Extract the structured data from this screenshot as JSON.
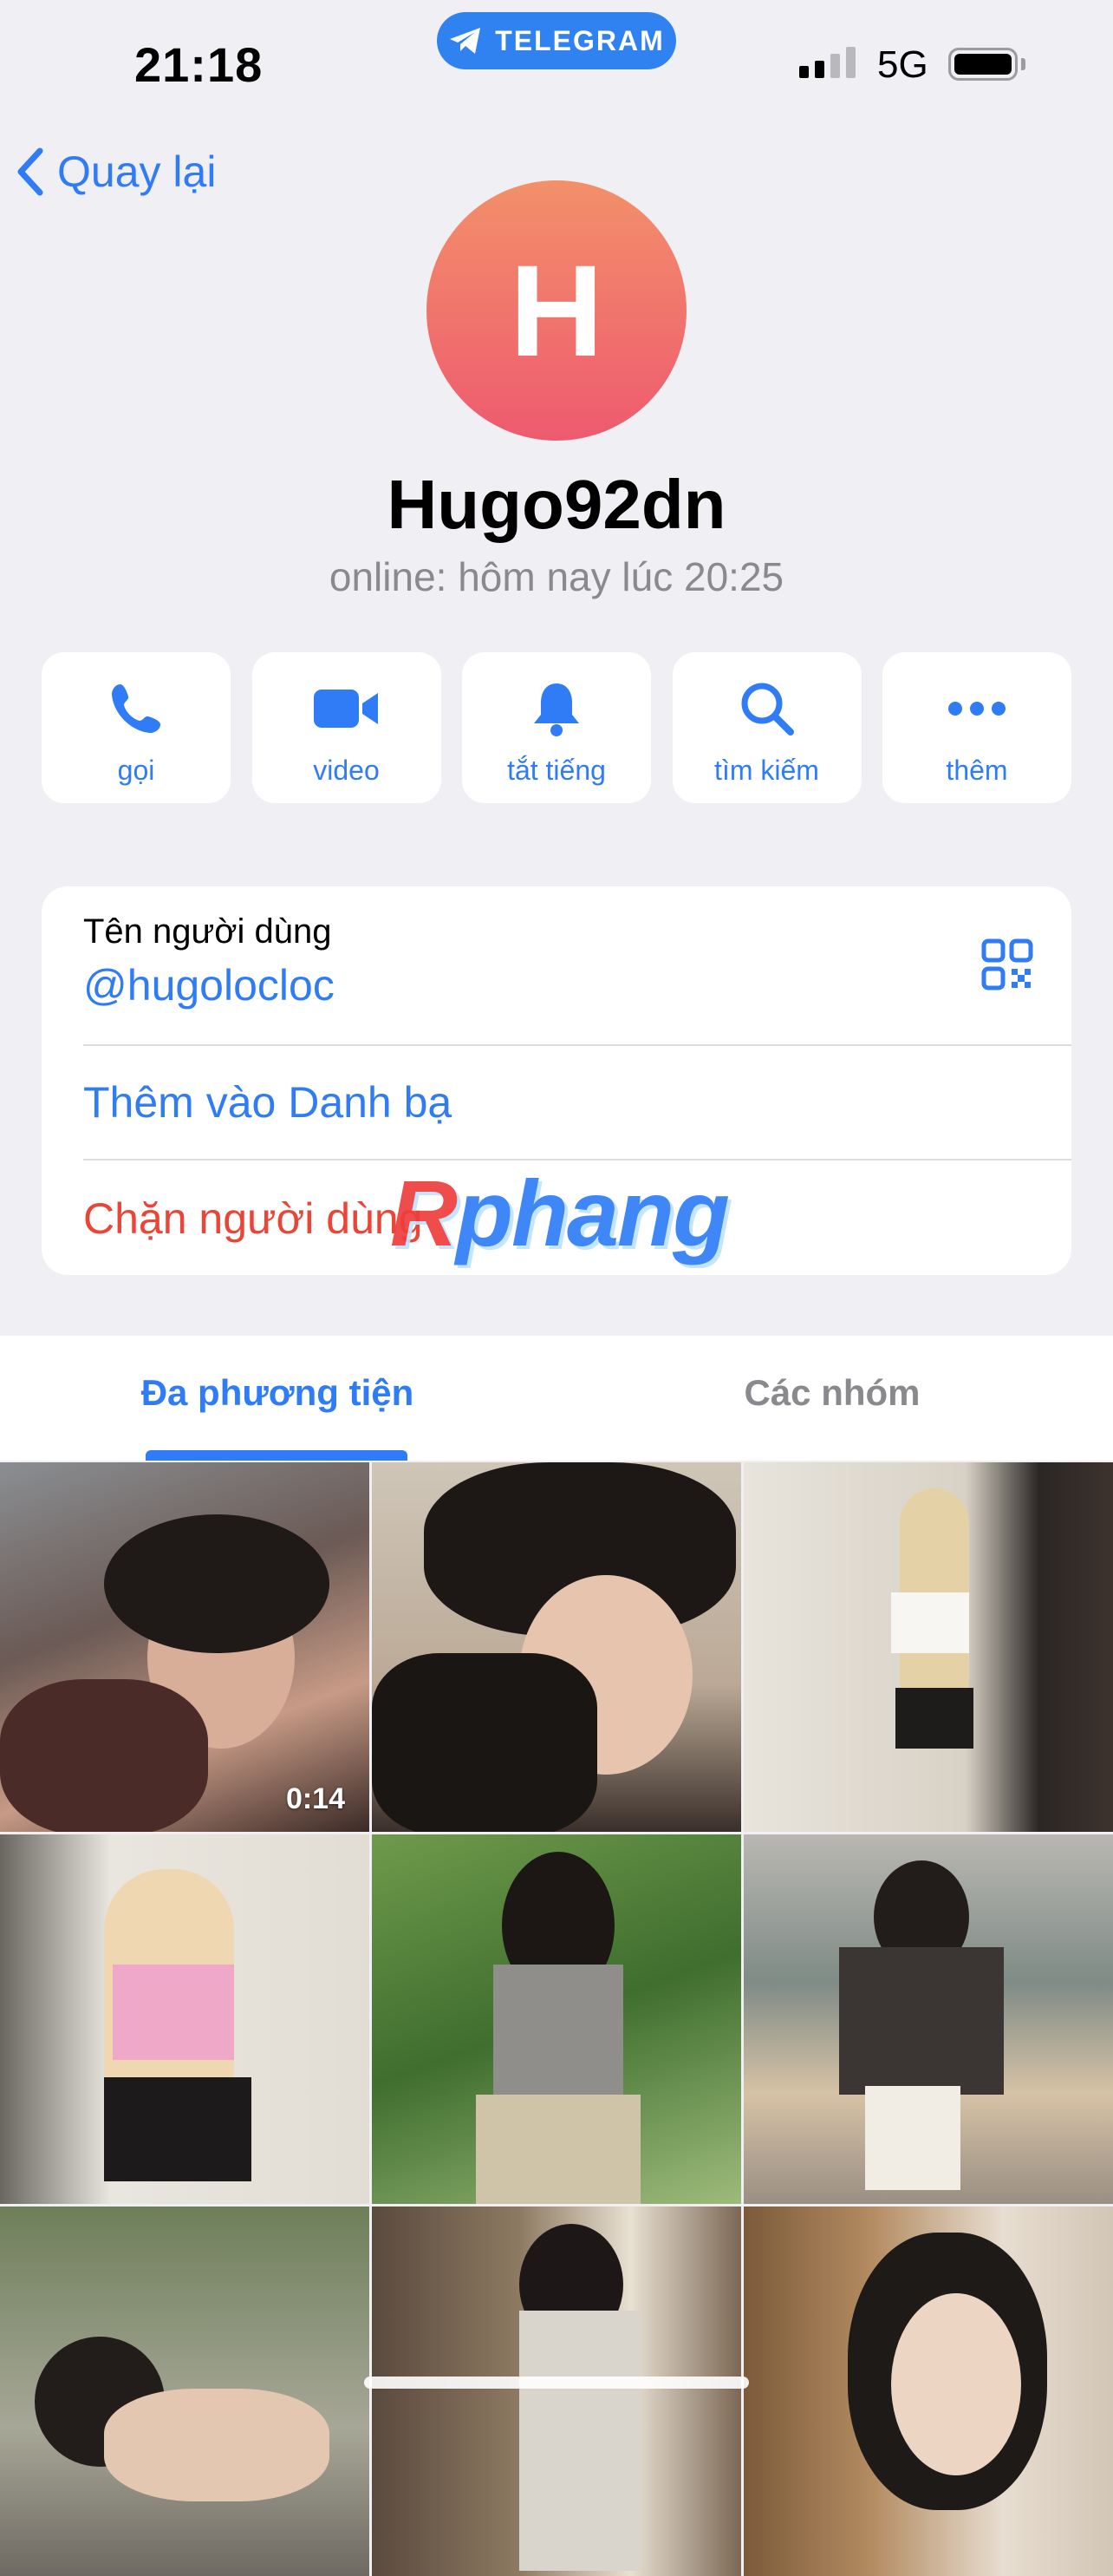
{
  "status_bar": {
    "time": "21:18",
    "app_pill": "TELEGRAM",
    "network": "5G"
  },
  "nav": {
    "back_label": "Quay lại"
  },
  "profile": {
    "avatar_letter": "H",
    "name": "Hugo92dn",
    "status": "online: hôm nay lúc 20:25"
  },
  "actions": [
    {
      "label": "gọi",
      "icon": "phone-icon"
    },
    {
      "label": "video",
      "icon": "video-camera-icon"
    },
    {
      "label": "tắt tiếng",
      "icon": "bell-icon"
    },
    {
      "label": "tìm kiếm",
      "icon": "search-icon"
    },
    {
      "label": "thêm",
      "icon": "more-icon"
    }
  ],
  "info": {
    "username_label": "Tên người dùng",
    "username_value": "@hugolocloc",
    "add_contact": "Thêm vào Danh bạ",
    "block_user": "Chặn người dùng"
  },
  "watermark": {
    "text": "Rphang"
  },
  "tabs": [
    {
      "label": "Đa phương tiện"
    },
    {
      "label": "Các nhóm"
    }
  ],
  "media": {
    "first_video_duration": "0:14"
  },
  "colors": {
    "accent": "#2f7cf6",
    "danger": "#eb4538",
    "background": "#efeff4",
    "avatar_top": "#f3906a",
    "avatar_bottom": "#ee5a6f"
  }
}
